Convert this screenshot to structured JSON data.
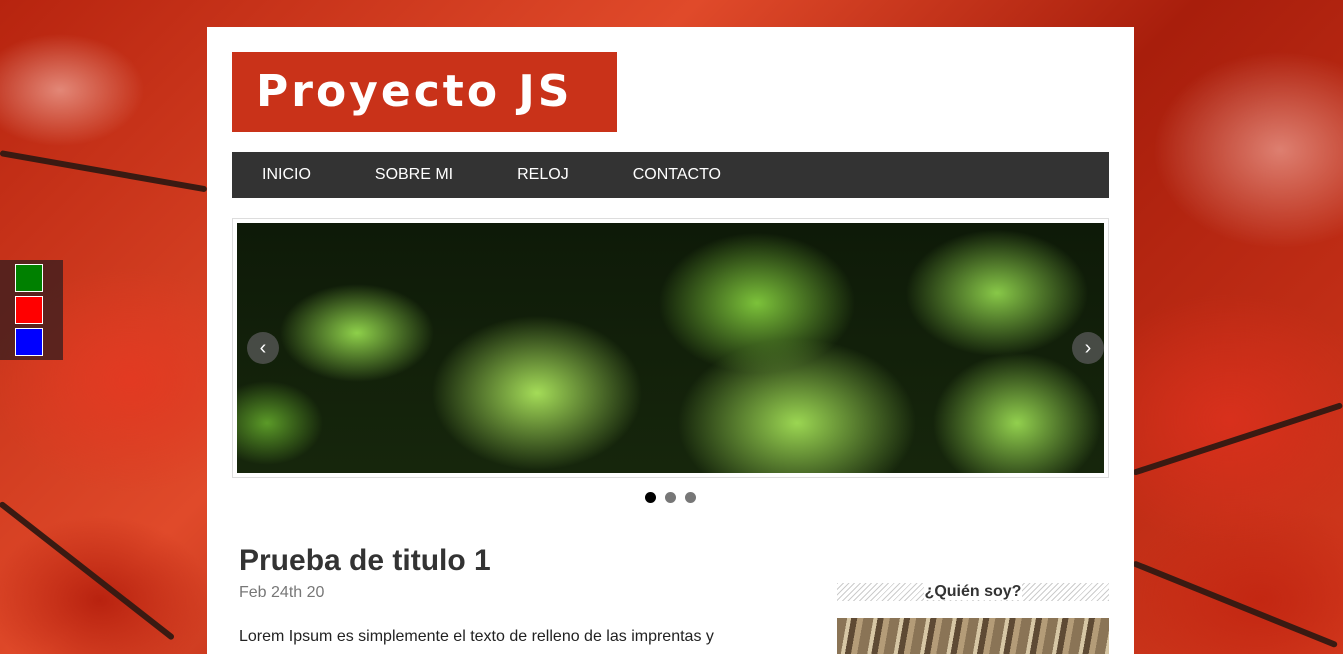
{
  "site": {
    "logo_text": "Proyecto JS"
  },
  "nav": {
    "items": [
      "INICIO",
      "SOBRE MI",
      "RELOJ",
      "CONTACTO"
    ]
  },
  "color_switcher": {
    "colors": [
      "#008000",
      "#ff0000",
      "#0000ff"
    ]
  },
  "slider": {
    "prev": "‹",
    "next": "›",
    "dot_count": 3,
    "active_index": 0
  },
  "post": {
    "title": "Prueba de titulo 1",
    "date": "Feb 24th 20",
    "text": "Lorem Ipsum es simplemente el texto de relleno de las imprentas y"
  },
  "sidebar": {
    "widget_title": "¿Quién soy?"
  }
}
